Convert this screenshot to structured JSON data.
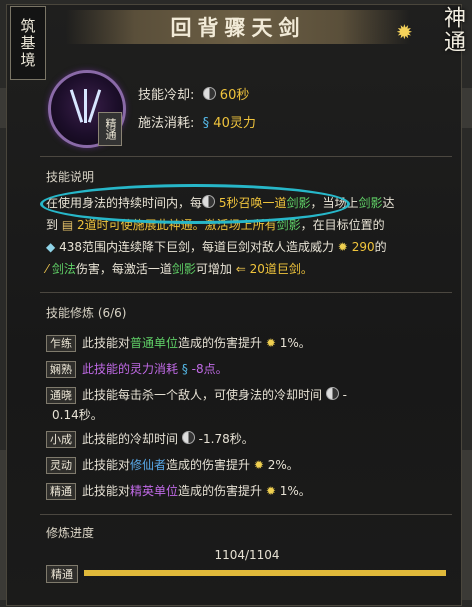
{
  "realm": "筑基境",
  "title": "回背骤天剑",
  "shentong_label": "神通",
  "mastery_tag": "精通",
  "stats": {
    "cooldown_label": "技能冷却:",
    "cooldown_value": "60秒",
    "cost_label": "施法消耗:",
    "cost_value": "40灵力"
  },
  "description": {
    "header": "技能说明",
    "line1_a": "在使用身法的持续时间内，每",
    "line1_b": "5秒召唤一道",
    "line1_c": "剑影",
    "line1_d": "，当场上",
    "line1_e": "剑影",
    "line1_f": "达",
    "line2_a": "到",
    "line2_b": "2道时可使施展此神通。激活场上所有",
    "line2_c": "剑影",
    "line2_d": "，在目标位置的",
    "line3_a": "438范围内连续降下巨剑，每道巨剑对敌人造成威力",
    "line3_b": "290",
    "line3_c": "的",
    "line4_a": "剑法",
    "line4_b": "伤害，每激活一道",
    "line4_c": "剑影",
    "line4_d": "可增加",
    "line4_e": "20道巨剑。"
  },
  "cultivation": {
    "header": "技能修炼 (6/6)",
    "rows": [
      {
        "badge": "乍练",
        "a": "此技能对",
        "hl": "普通单位",
        "b": "造成的伤害提升",
        "v": "1%。"
      },
      {
        "badge": "娴熟",
        "a": "此技能的灵力消耗",
        "v": "-8点。"
      },
      {
        "badge": "通晓",
        "a": "此技能每击杀一个敌人，可使身法的冷却时间",
        "v": "-"
      },
      {
        "badge": "",
        "a": "0.14秒。"
      },
      {
        "badge": "小成",
        "a": "此技能的冷却时间",
        "v": "-1.78秒。"
      },
      {
        "badge": "灵动",
        "a": "此技能对",
        "hl": "修仙者",
        "b": "造成的伤害提升",
        "v": "2%。"
      },
      {
        "badge": "精通",
        "a": "此技能对",
        "hl": "精英单位",
        "b": "造成的伤害提升",
        "v": "1%。"
      }
    ]
  },
  "progress": {
    "label": "修炼进度",
    "count": "1104/1104",
    "tag": "精通",
    "fraction": 1.0
  }
}
